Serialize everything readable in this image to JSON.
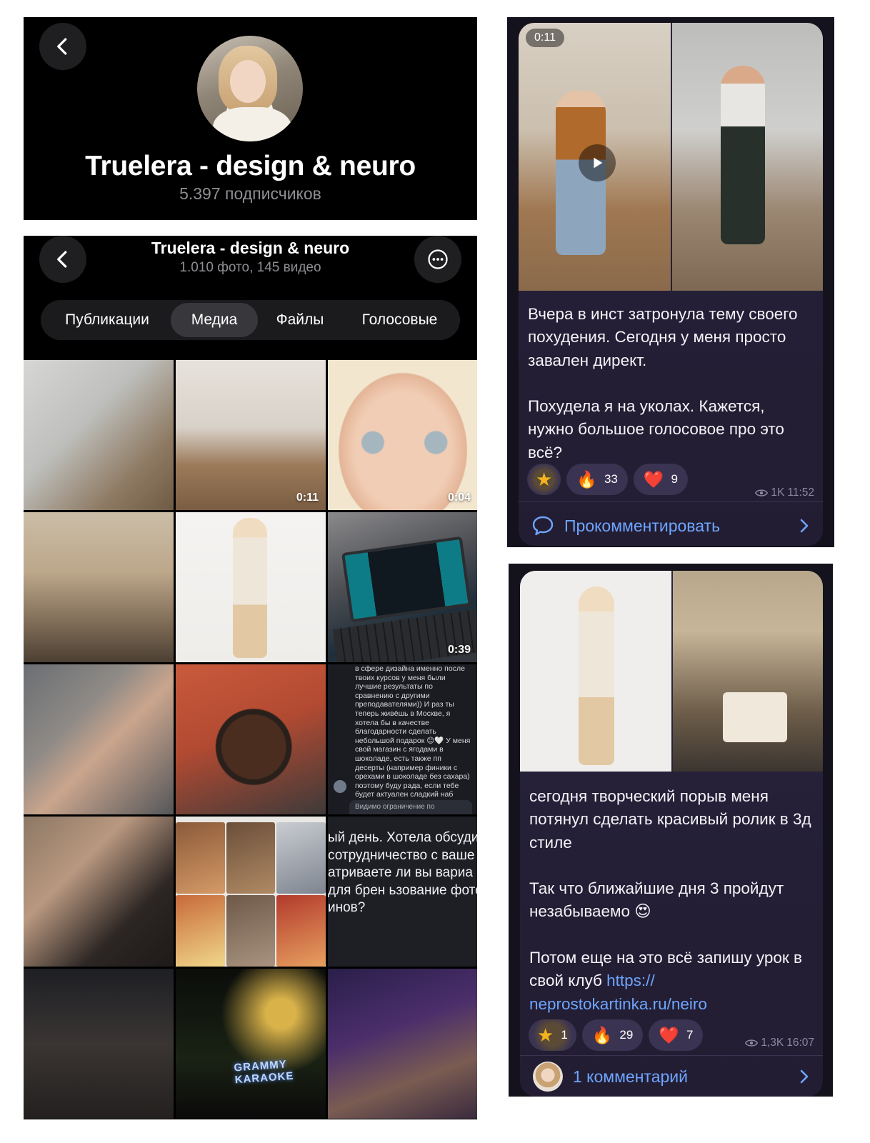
{
  "profile_header": {
    "title": "Truelera - design & neuro",
    "subscribers": "5.397 подписчиков",
    "back_icon": "chevron-left-icon"
  },
  "media_screen": {
    "title": "Truelera - design & neuro",
    "counts": "1.010 фото, 145 видео",
    "tabs": [
      {
        "label": "Публикации",
        "selected": false
      },
      {
        "label": "Медиа",
        "selected": true
      },
      {
        "label": "Файлы",
        "selected": false
      },
      {
        "label": "Голосовые",
        "selected": false
      }
    ],
    "grid": [
      {
        "kind": "photo",
        "duration": ""
      },
      {
        "kind": "video",
        "duration": "0:11"
      },
      {
        "kind": "video",
        "duration": "0:04"
      },
      {
        "kind": "photo",
        "duration": ""
      },
      {
        "kind": "photo",
        "duration": ""
      },
      {
        "kind": "video",
        "duration": "0:39"
      },
      {
        "kind": "photo",
        "duration": ""
      },
      {
        "kind": "photo",
        "duration": ""
      },
      {
        "kind": "screenshot",
        "duration": ""
      },
      {
        "kind": "photo",
        "duration": ""
      },
      {
        "kind": "screenshot",
        "duration": ""
      },
      {
        "kind": "screenshot",
        "duration": ""
      },
      {
        "kind": "photo",
        "duration": ""
      },
      {
        "kind": "photo",
        "duration": ""
      },
      {
        "kind": "photo",
        "duration": ""
      }
    ],
    "chat_screenshot": {
      "message": "в сфере дизайна именно после твоих курсов у меня были лучшие результаты по сравнению с другими преподавателями)) И раз ты теперь живёшь в Москве, я хотела бы в качестве благодарности сделать небольшой подарок 😊🤍 У меня свой магазин с ягодами в шоколаде, есть также пп десерты (например финики с орехами в шоколаде без сахара) поэтому буду рада, если тебе будет актуален сладкий наб",
      "note": "Видимо ограничение по"
    },
    "chat_screenshot_2": {
      "message": "ый день. Хотела обсуди сотрудничество с ваше пью. атриваете ли вы вариа ие в кампейне для брен ьзование фото для вит инов?"
    },
    "karaoke_sign": "GRAMMY KARAOKE"
  },
  "post_1": {
    "video_duration": "0:11",
    "text": "Вчера в инст затронула тему своего похудения. Сегодня у меня просто завален директ.\n\nПохудела я на уколах. Кажется, нужно большое голосовое про это всё?",
    "reactions": [
      {
        "emoji": "⭐",
        "count": ""
      },
      {
        "emoji": "🔥",
        "count": "33"
      },
      {
        "emoji": "❤️",
        "count": "9"
      }
    ],
    "views": "1K",
    "time": "11:52",
    "comment_label": "Прокомментировать"
  },
  "post_2": {
    "text": "сегодня творческий порыв меня потянул сделать красивый ролик в 3д стиле\n\nТак что ближайшие дня 3 пройдут незабываемо 😍\n\nПотом еще на это всё запишу урок в свой клуб ",
    "link": "https://\nneprostokartinka.ru/neiro",
    "reactions": [
      {
        "emoji": "⭐",
        "count": "1"
      },
      {
        "emoji": "🔥",
        "count": "29"
      },
      {
        "emoji": "❤️",
        "count": "7"
      }
    ],
    "views": "1,3K",
    "time": "16:07",
    "comment_label": "1 комментарий"
  },
  "colors": {
    "accent_link": "#6ea5ff",
    "bubble_bg": "#2a2540",
    "panel_bg": "#000000"
  }
}
